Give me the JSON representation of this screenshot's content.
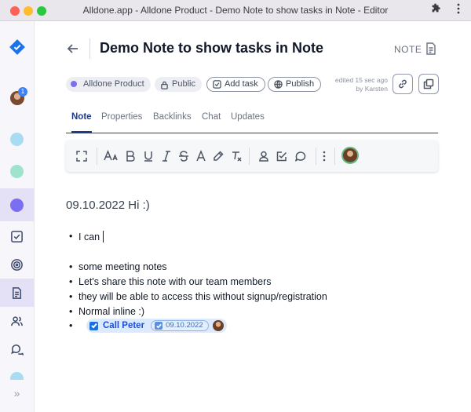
{
  "window": {
    "title": "Alldone.app - Alldone Product - Demo Note to show tasks in Note - Editor"
  },
  "sidebar": {
    "notification_count": "1",
    "collapse_label": "»",
    "project_colors": [
      "#a8dcf2",
      "#9fe3cc",
      "#7b6ef2",
      "#a8dcf2"
    ]
  },
  "header": {
    "title": "Demo Note to show tasks in Note",
    "type_label": "NOTE"
  },
  "chips": {
    "project": "Alldone Product",
    "visibility": "Public",
    "add_task": "Add task",
    "publish": "Publish"
  },
  "edited": {
    "line1": "edited 15 sec ago",
    "line2": "by Karsten"
  },
  "tabs": [
    "Note",
    "Properties",
    "Backlinks",
    "Chat",
    "Updates"
  ],
  "active_tab": "Note",
  "editor": {
    "heading": "09.10.2022 Hi :)",
    "bullets": [
      "I can",
      "some meeting notes",
      "Let's share this note with our team members",
      "they will be able to access this without signup/registration",
      "Normal inline :)"
    ],
    "task": {
      "name": "Call Peter",
      "date": "09.10.2022",
      "done": true
    }
  },
  "colors": {
    "accent": "#1e3a8a",
    "task_blue": "#1d6fe0",
    "brand": "#1a73e8"
  }
}
